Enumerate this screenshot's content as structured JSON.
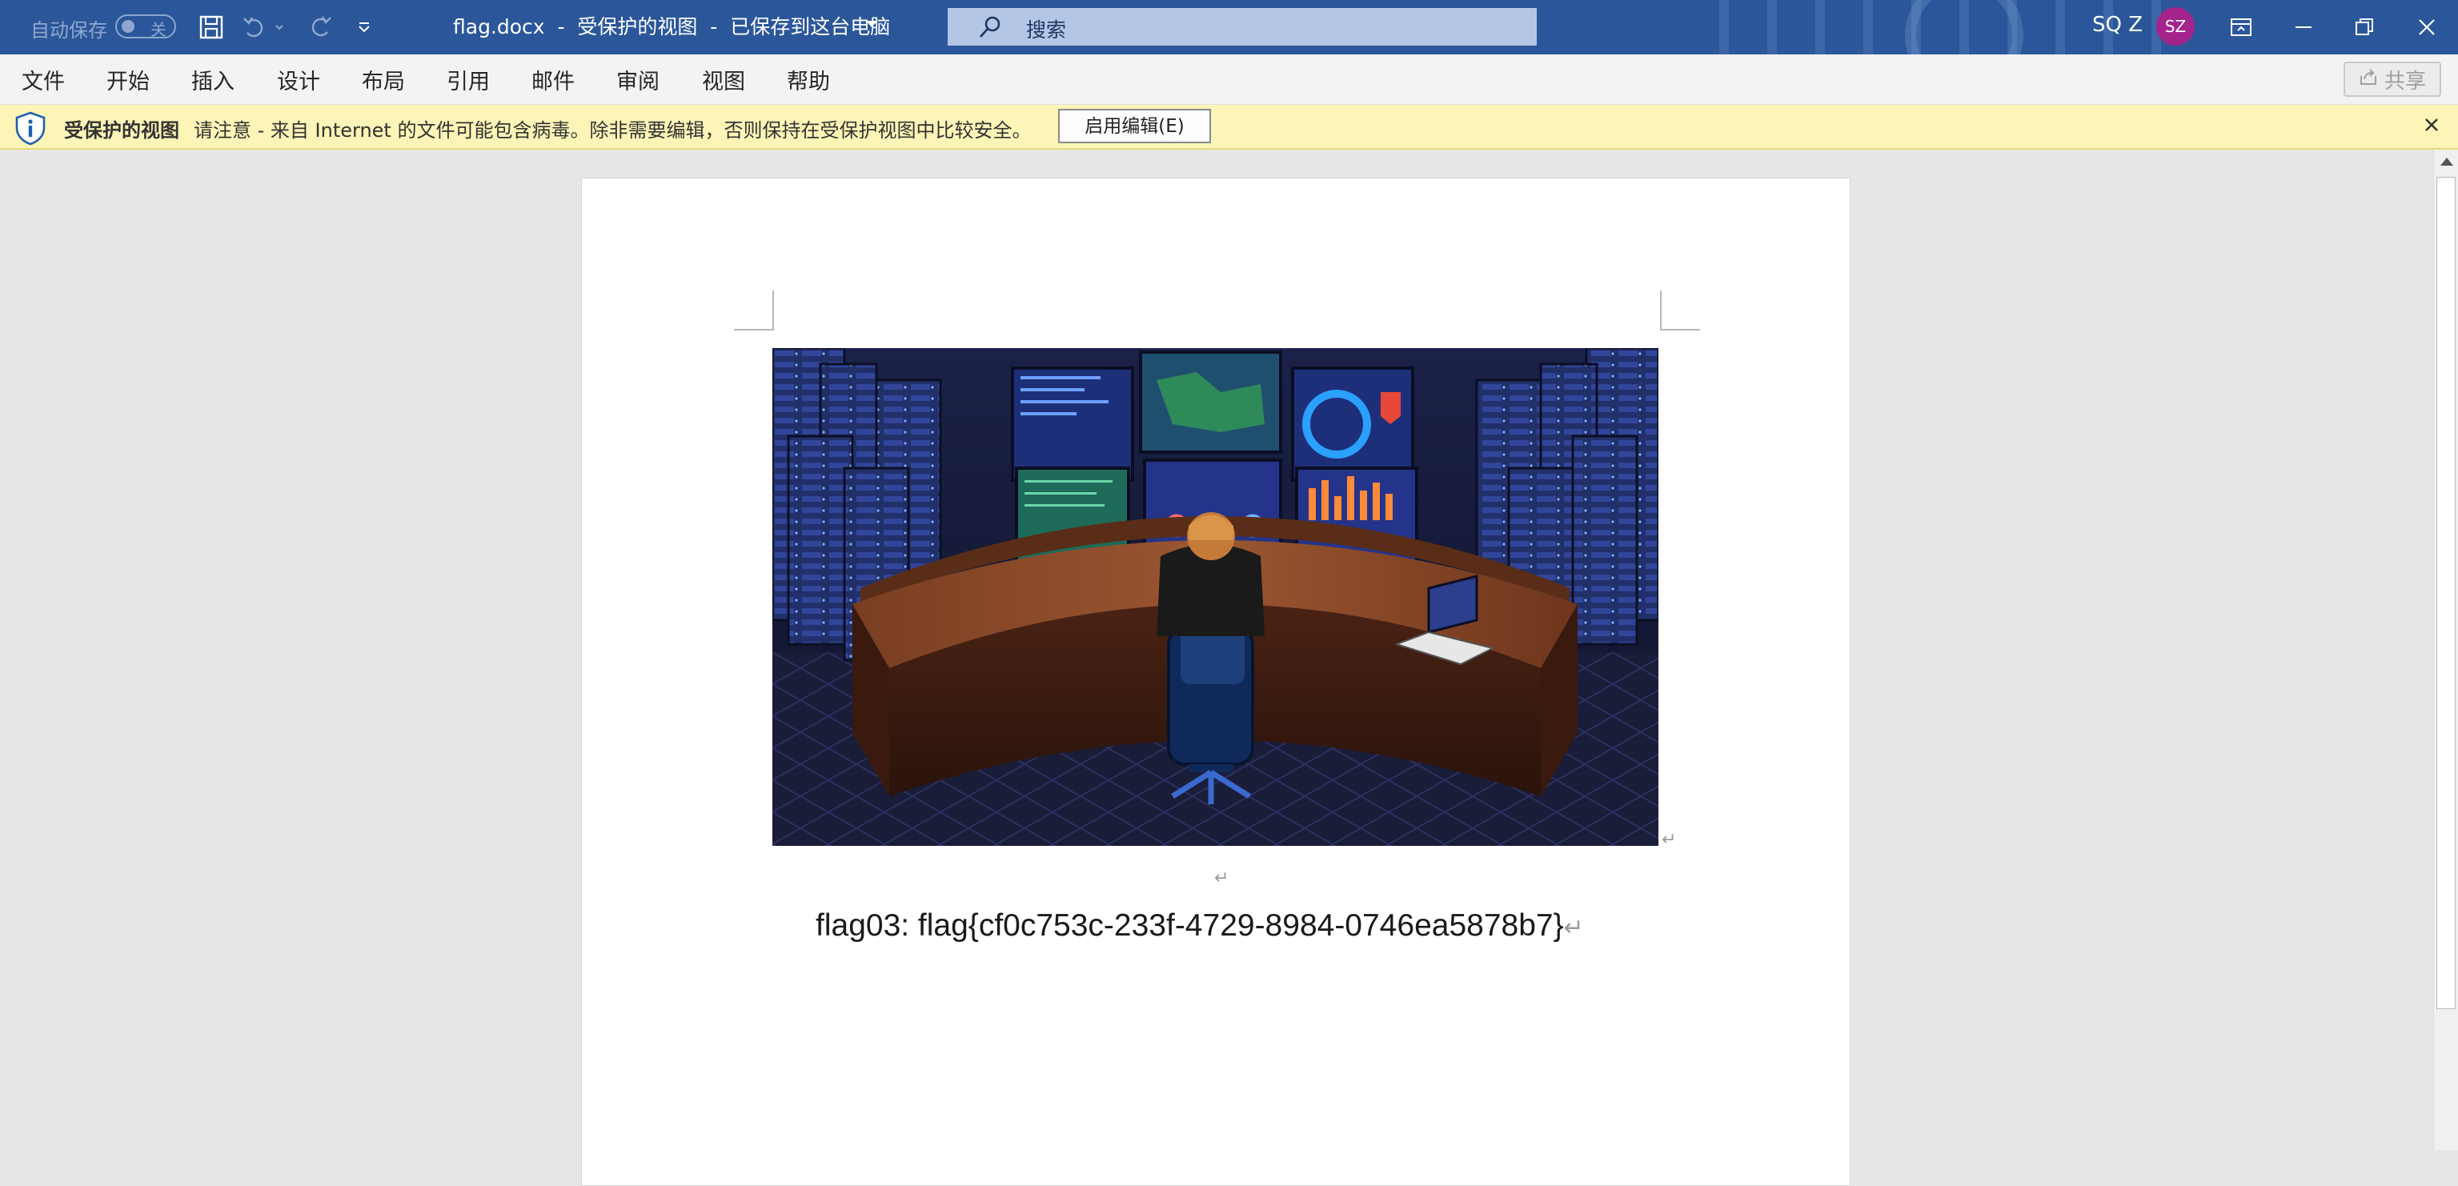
{
  "titlebar": {
    "autosave_label": "自动保存",
    "autosave_state": "关",
    "document_title": "flag.docx  -  受保护的视图  -  已保存到这台电脑",
    "search_placeholder": "搜索",
    "user_name": "SQ Z",
    "avatar_initials": "SZ",
    "accent_color": "#2b579a"
  },
  "ribbon": {
    "tabs": [
      "文件",
      "开始",
      "插入",
      "设计",
      "布局",
      "引用",
      "邮件",
      "审阅",
      "视图",
      "帮助"
    ],
    "share_label": "共享"
  },
  "protected_view": {
    "title": "受保护的视图",
    "message": "请注意 - 来自 Internet 的文件可能包含病毒。除非需要编辑，否则保持在受保护视图中比较安全。",
    "enable_button": "启用编辑(E)",
    "bar_color": "#fcf5b7"
  },
  "document": {
    "flag_text": "flag03: flag{cf0c753c-233f-4729-8984-0746ea5878b7}",
    "paragraph_mark": "↵"
  },
  "icons": {
    "save": "save-icon",
    "undo": "undo-icon",
    "redo": "redo-icon",
    "customize": "customize-quick-access-icon",
    "search": "search-icon",
    "ribbon_display": "ribbon-display-options-icon",
    "minimize": "minimize-icon",
    "restore": "restore-icon",
    "close": "close-icon",
    "info": "info-icon",
    "share": "share-icon"
  }
}
